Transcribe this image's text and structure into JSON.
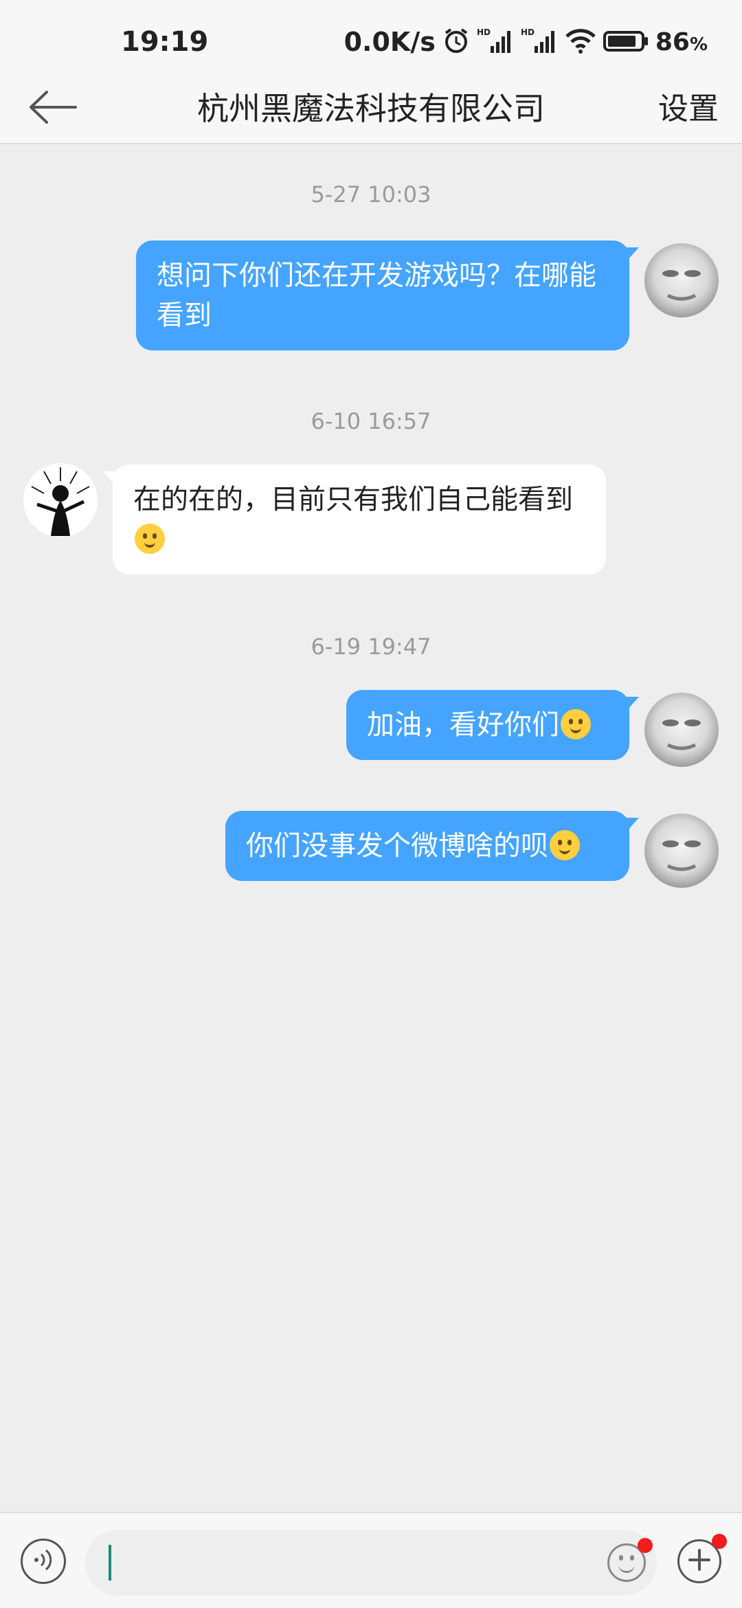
{
  "status_bar": {
    "time": "19:19",
    "net_speed": "0.0K/s",
    "battery_percent": "86",
    "battery_unit": "%",
    "battery_level": 0.86,
    "icons": [
      "alarm-icon",
      "hd-signal-icon",
      "hd-signal-icon",
      "wifi-icon",
      "battery-icon"
    ]
  },
  "header": {
    "back_icon": "arrow-left-icon",
    "title": "杭州黑魔法科技有限公司",
    "settings_label": "设置"
  },
  "messages": [
    {
      "timestamp": "5-27 10:03"
    },
    {
      "sender": "me",
      "text": "想问下你们还在开发游戏吗？在哪能看到"
    },
    {
      "timestamp": "6-10 16:57"
    },
    {
      "sender": "them",
      "text": "在的在的，目前只有我们自己能看到",
      "emoji": "kissing-face-icon"
    },
    {
      "timestamp": "6-19 19:47"
    },
    {
      "sender": "me",
      "text": "加油，看好你们",
      "emoji": "crying-face-icon"
    },
    {
      "sender": "me",
      "text": "你们没事发个微博啥的呗",
      "emoji": "tears-of-joy-icon"
    }
  ],
  "input_bar": {
    "voice_icon": "voice-wave-icon",
    "input_value": "",
    "emoji_icon": "smiley-icon",
    "add_icon": "plus-circle-icon"
  },
  "colors": {
    "outgoing_bubble": "#44a4ff",
    "incoming_bubble": "#ffffff",
    "chat_background": "#eeeeee",
    "badge": "#f21c1c",
    "caret": "#1b8a78"
  }
}
